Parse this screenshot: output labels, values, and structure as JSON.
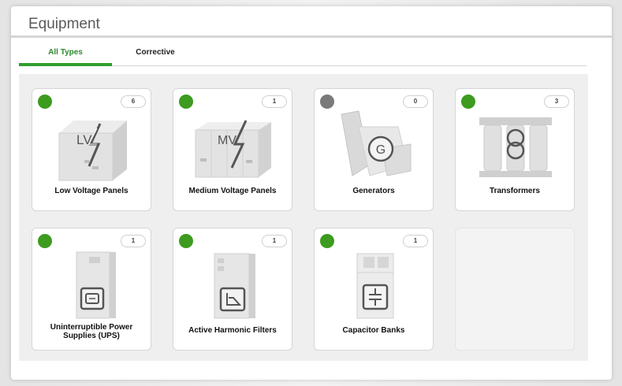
{
  "panel": {
    "title": "Equipment"
  },
  "tabs": [
    {
      "label": "All Types",
      "active": true
    },
    {
      "label": "Corrective",
      "active": false
    }
  ],
  "colors": {
    "ok": "#3d9b1f",
    "offline": "#7a7a7a",
    "accent": "#2f9e2f"
  },
  "cards": [
    {
      "label": "Low Voltage Panels",
      "count": "6",
      "status": "ok",
      "icon": "lv-panel-icon"
    },
    {
      "label": "Medium Voltage Panels",
      "count": "1",
      "status": "ok",
      "icon": "mv-panel-icon"
    },
    {
      "label": "Generators",
      "count": "0",
      "status": "offline",
      "icon": "generator-icon"
    },
    {
      "label": "Transformers",
      "count": "3",
      "status": "ok",
      "icon": "transformer-icon"
    },
    {
      "label": "Uninterruptible Power Supplies (UPS)",
      "count": "1",
      "status": "ok",
      "icon": "ups-icon"
    },
    {
      "label": "Active Harmonic Filters",
      "count": "1",
      "status": "ok",
      "icon": "harmonic-filter-icon"
    },
    {
      "label": "Capacitor Banks",
      "count": "1",
      "status": "ok",
      "icon": "capacitor-bank-icon"
    }
  ],
  "icon_text": {
    "lv": "LV",
    "mv": "MV",
    "generator": "G"
  }
}
